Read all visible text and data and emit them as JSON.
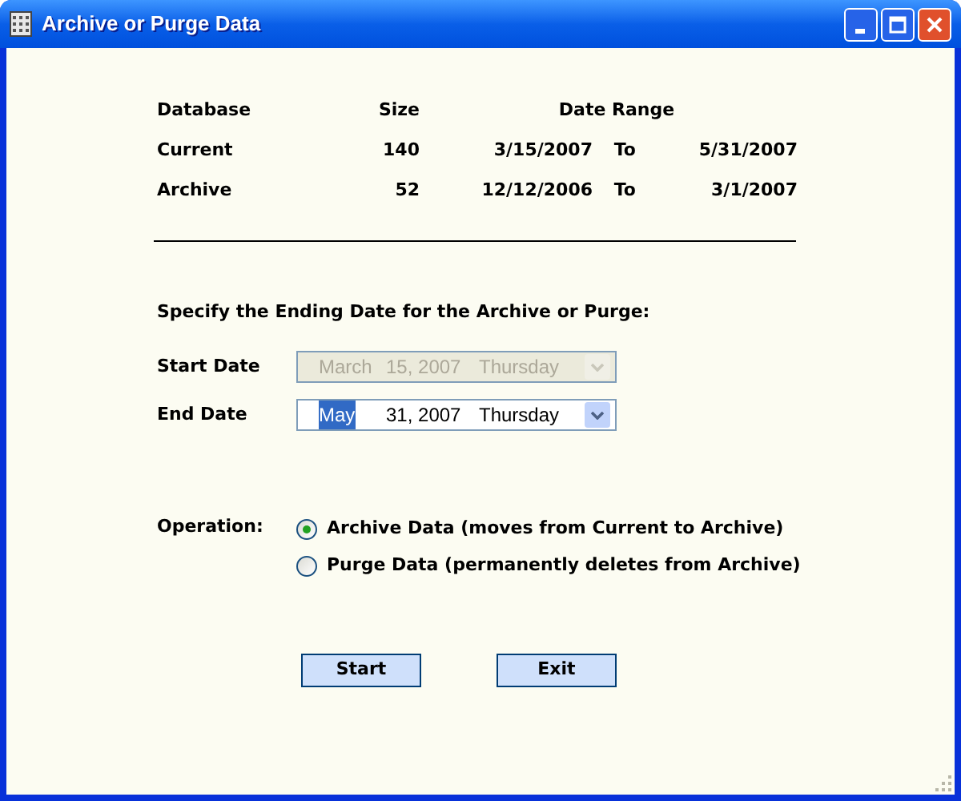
{
  "window": {
    "title": "Archive or Purge Data"
  },
  "table": {
    "columns": [
      "Database",
      "Size",
      "Date Range"
    ],
    "rows": [
      {
        "database": "Current",
        "size": "140",
        "from": "3/15/2007",
        "to_label": "To",
        "to": "5/31/2007"
      },
      {
        "database": "Archive",
        "size": "52",
        "from": "12/12/2006",
        "to_label": "To",
        "to": "3/1/2007"
      }
    ]
  },
  "instruction": "Specify the Ending Date for the Archive or Purge:",
  "date_fields": [
    {
      "label": "Start Date",
      "month": "March",
      "day_year": "15, 2007",
      "weekday": "Thursday",
      "disabled": true,
      "month_selected": false
    },
    {
      "label": "End Date",
      "month": "May",
      "day_year": "31, 2007",
      "weekday": "Thursday",
      "disabled": false,
      "month_selected": true
    }
  ],
  "operation": {
    "label": "Operation:",
    "options": [
      {
        "label": "Archive Data (moves from Current to Archive)",
        "selected": true
      },
      {
        "label": "Purge Data (permanently deletes from Archive)",
        "selected": false
      }
    ]
  },
  "buttons": [
    "Start",
    "Exit"
  ]
}
